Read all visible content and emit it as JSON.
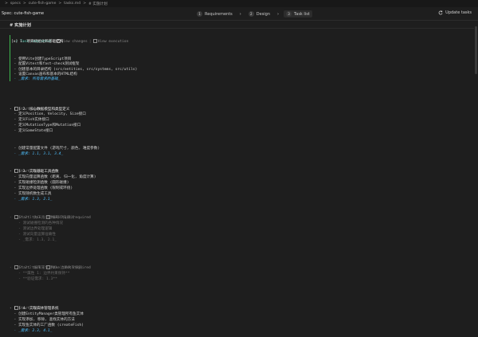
{
  "breadcrumb": [
    ">",
    "specs",
    ">",
    "cute-fish-game",
    ">",
    "tasks.md",
    ">",
    "# 实施计划"
  ],
  "spec_title": "Spec: cute-fish-game",
  "steps": [
    {
      "num": "1",
      "label": "Requirements"
    },
    {
      "num": "2",
      "label": "Design"
    },
    {
      "num": "3",
      "label": "Task list"
    }
  ],
  "update_label": "Update tasks",
  "heading": "# 实施计划",
  "lines": {
    "t1_lens_status": "✓ Task completed",
    "t1_lens_changes": "View changes",
    "t1_lens_exec": "View execution",
    "t1_title": "[x] 1. 项目初始化和基础结构",
    "t1_l1": "  - 使用Vite创建TypeScript项目",
    "t1_l2": "  - 配置Vitest和fast-check测试框架",
    "t1_l3": "  - 创建基本的目录结构 (src/entities, src/systems, src/utils)",
    "t1_l4": "  - 设置Canvas画布和基本的HTML结构",
    "t1_l5": "  - _需求: 所有需求的基础_",
    "t2_lens": "Start task",
    "t2_title": "- [ ] 2. 核心数据模型和类型定义",
    "t2_l1": "  - 定义Position, Velocity, Size接口",
    "t2_l2": "  - 定义Fish实体接口",
    "t2_l3": "  - 定义MutationType和Mutation接口",
    "t2_l4": "  - 定义GameState接口",
    "t2_l5": "  - 创建常量配置文件 (游戏尺寸, 颜色, 难度参数)",
    "t2_l6": "  - _需求: 1.1, 3.1, 3.4_",
    "t3_lens": "Start task",
    "t3_title": "- [ ] 3. 实现基础工具函数",
    "t3_l1": "  - 实现向量运算函数 (距离, 归一化, 角度计算)",
    "t3_l2": "  - 实现碰撞检测函数 (圆形碰撞)",
    "t3_l3": "  - 实现边界处理函数 (限制或环绕)",
    "t3_l4": "  - 实现随机数生成工具",
    "t3_l5": "  - _需求: 1.3, 2.1_",
    "t31_lens_start": "Start task",
    "t31_lens_req": "Make task required",
    "t31_title": "- [ ]* 3.1 为工具函数编写单元测试",
    "t31_l1": "    - 测试碰撞检测的各种情况",
    "t31_l2": "    - 测试边界处理逻辑",
    "t31_l3": "    - 测试向量运算准确性",
    "t31_l4": "    - _需求: 1.3, 2.1_",
    "t32_lens_start": "Start task",
    "t32_lens_req": "Make task required",
    "t32_title": "- [ ]* 3.2 编写属性测试: 边界约束保持",
    "t32_l1": "    - **属性 1: 边界约束保持**",
    "t32_l2": "    - **验证需求: 1.3**",
    "t4_lens": "Start task",
    "t4_title": "- [ ] 4. 实现实体管理系统",
    "t4_l1": "  - 创建EntityManager类管理所有鱼实体",
    "t4_l2": "  - 实现添加, 移除, 查找实体的方法",
    "t4_l3": "  - 实现鱼实体的工厂函数 (createFish)",
    "t4_l4": "  - _需求: 2.3, 4.1_"
  }
}
